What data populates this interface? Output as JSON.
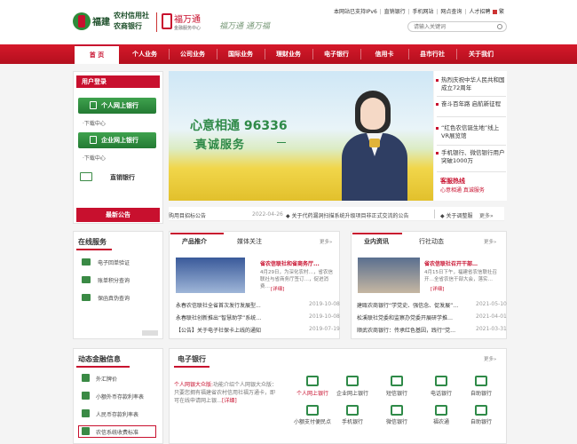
{
  "header": {
    "bank_name_1": "福建",
    "bank_name_2": "农村信用社",
    "bank_name_3": "农商银行",
    "fwt_brand": "福万通",
    "fwt_sub": "金融服务中心",
    "slogan": "福万通 通万福",
    "top_links": [
      "本网站已支持IPv6",
      "直销银行",
      "手机网站",
      "网点查询",
      "人才招聘"
    ],
    "lang_label": "繁",
    "search_placeholder": "请输入关键词"
  },
  "nav": {
    "items": [
      "首 页",
      "个人业务",
      "公司业务",
      "国际业务",
      "理财业务",
      "电子银行",
      "信用卡",
      "县市行社",
      "关于我们"
    ]
  },
  "login": {
    "title": "用户登录",
    "personal_button": "个人网上银行",
    "personal_link": "下载中心",
    "corporate_button": "企业网上银行",
    "corporate_link": "下载中心",
    "direct_bank": "直销银行"
  },
  "banner": {
    "title": "心意相通 96336",
    "subtitle": "真诚服务"
  },
  "side_news": {
    "items": [
      "热烈庆祝中华人民共和国成立72周年",
      "奋斗百年路 启航新征程",
      "“红色农信诞生地”线上VR展览馆",
      "手机银行、微信银行用户突破1000万"
    ],
    "hotline_title": "客服热线",
    "hotline_sub": "心意相通 真诚服务"
  },
  "ticker": {
    "label": "最新公告",
    "item1": "购用目招标公告",
    "date1": "2022-04-26",
    "item2": "关于代药漏洞扫描系统升级项目非正式交流的公告",
    "item3": "关于调整服",
    "more": "更多»"
  },
  "online_service": {
    "title": "在线服务",
    "items": [
      "电子回单验证",
      "账单积分查询",
      "保函真伪查询"
    ]
  },
  "products": {
    "tab1": "产品推介",
    "tab2": "媒体关注",
    "more": "更多»",
    "feature_title": "省农信联社和省商务厅...",
    "feature_text": "4月29日，为深化农村…，省农信联社与省商务厅签订…，促进消费…",
    "feature_link": "[详细]",
    "list": [
      {
        "title": "永春农信联社全省首次发行发展型...",
        "date": "2019-10-08"
      },
      {
        "title": "永春联社创新推出“智慧助学”系统…",
        "date": "2019-10-08"
      },
      {
        "title": "【公告】关于电子社保卡上线的通知",
        "date": "2019-07-19"
      }
    ]
  },
  "industry": {
    "tab1": "业内资讯",
    "tab2": "行社动态",
    "more": "更多»",
    "feature_title": "省农信联社召开干部…",
    "feature_text": "4月15日下午，福建省农信联社召开…全省农信干部大会，落实…",
    "feature_link": "[详细]",
    "list": [
      {
        "title": "建瓯农商银行“学党史、强信念、促发展”…",
        "date": "2021-05-10"
      },
      {
        "title": "松溪联社党委和监察办党委开展研学推…",
        "date": "2021-04-01"
      },
      {
        "title": "顺武农商银行：传承红色基因，践行“党…",
        "date": "2021-03-31"
      }
    ]
  },
  "dynamic": {
    "title": "动态金融信息",
    "items": [
      "外汇牌价",
      "小额外币存款利率表",
      "人民币存款利率表",
      "农信系统收费标准"
    ]
  },
  "ebank": {
    "title": "电子银行",
    "more": "更多»",
    "desc_link": "个人网银大众版:",
    "desc": "功能介绍个人网银大众版：只要您拥有福建省农村信用社福万通卡，即可在线申请网上银…",
    "desc_link2": "[详细]",
    "items": [
      "个人网上银行",
      "企业网上银行",
      "短信银行",
      "电话银行",
      "自助银行",
      "小额支付便民点",
      "手机银行",
      "微信银行",
      "福农通",
      "自助银行"
    ]
  }
}
